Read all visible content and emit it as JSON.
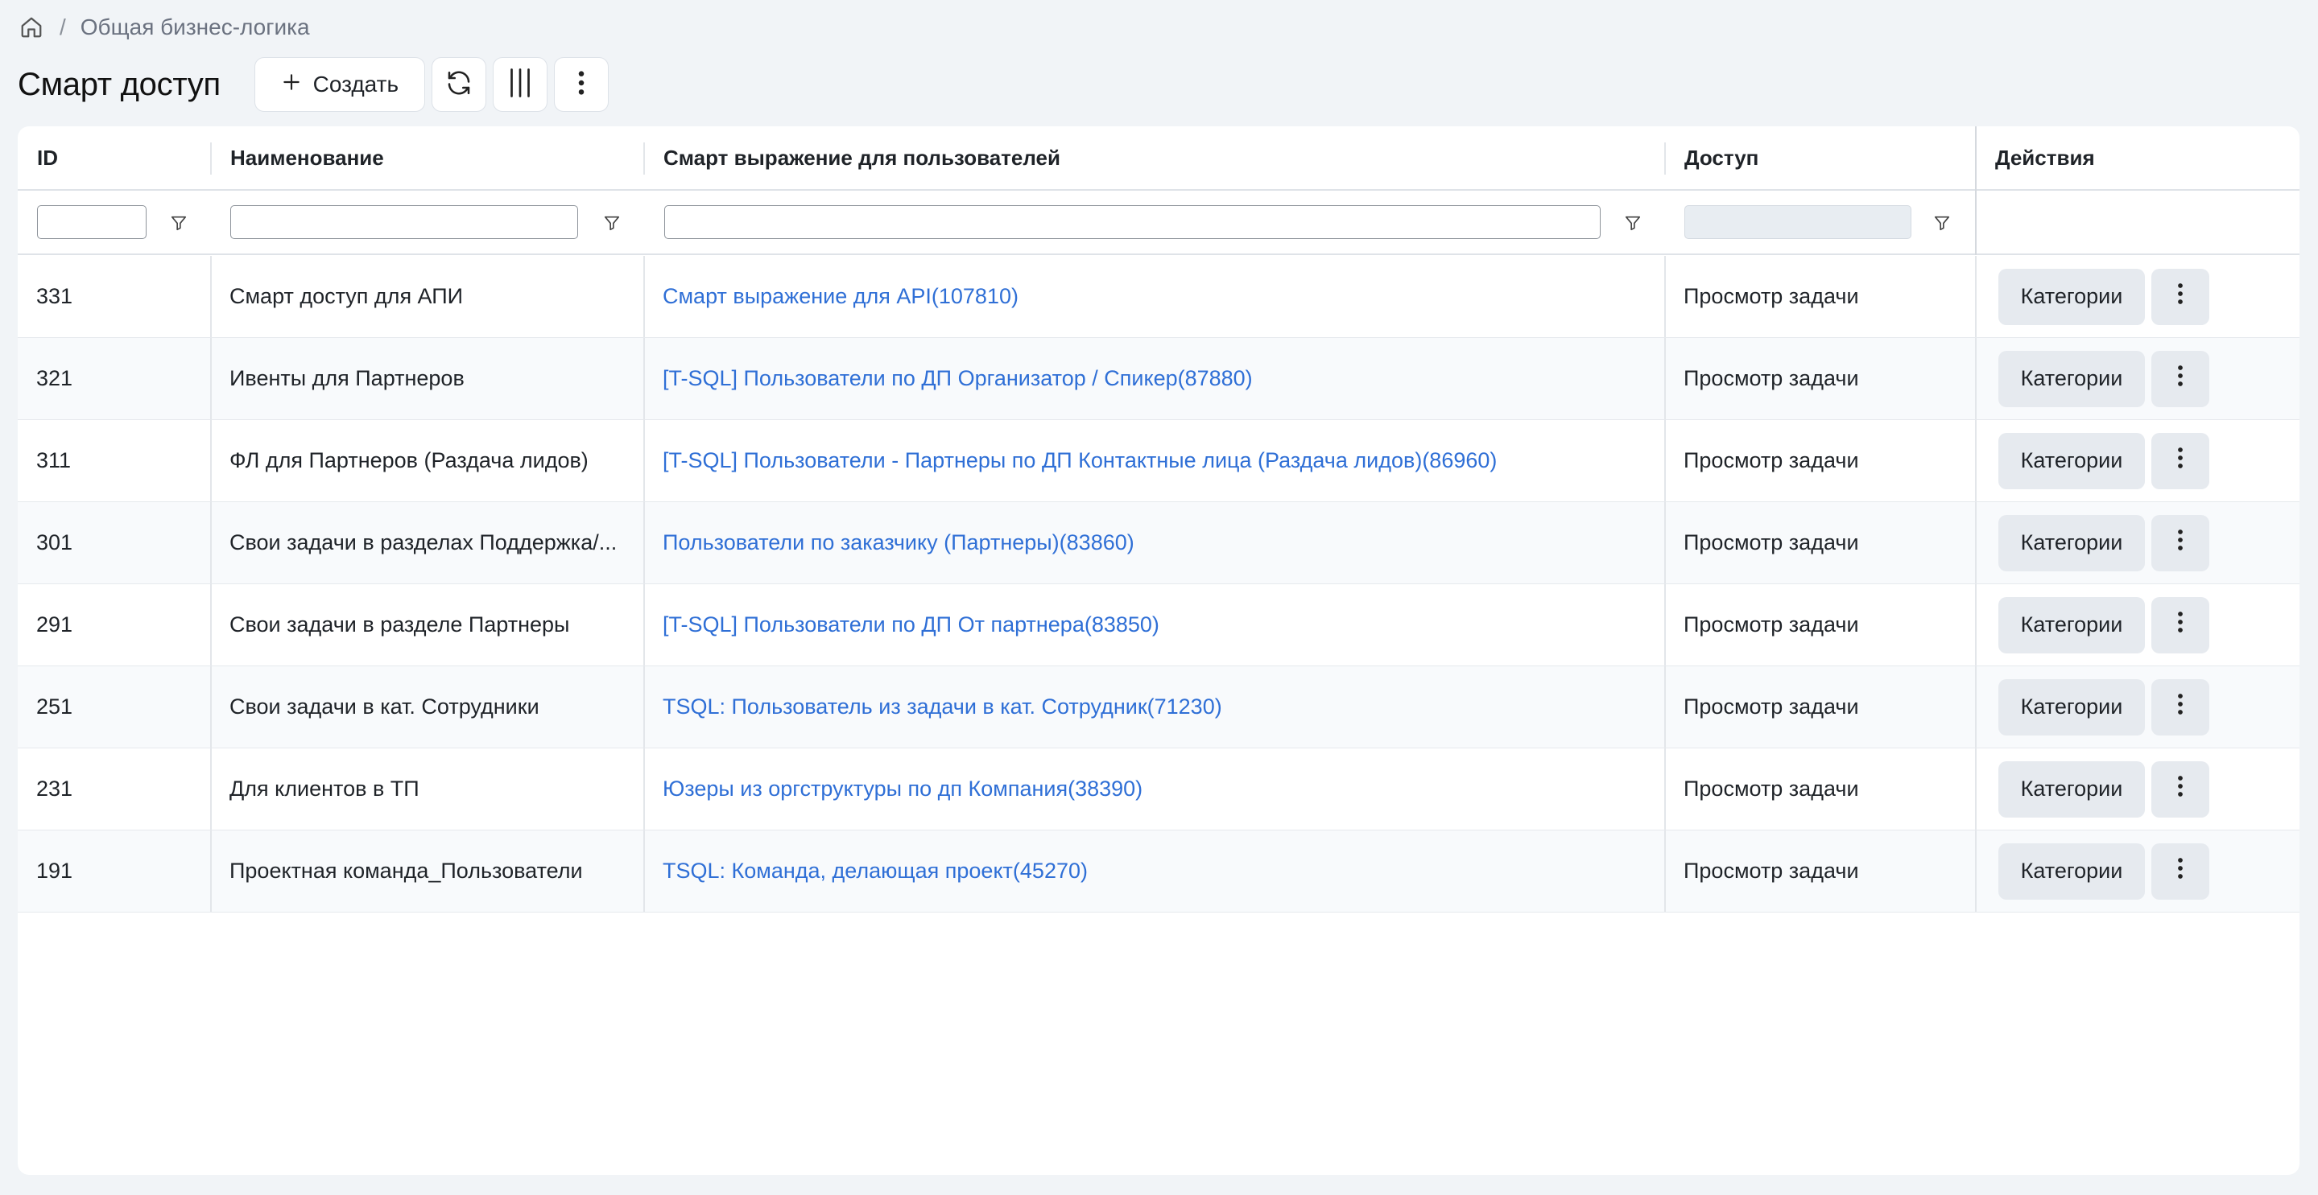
{
  "breadcrumb": {
    "home_icon": "home-icon",
    "separator": "/",
    "current": "Общая бизнес-логика"
  },
  "header": {
    "title": "Смарт доступ",
    "create_label": "Создать",
    "create_icon": "plus-icon",
    "refresh_icon": "refresh-icon",
    "columns_icon": "columns-icon",
    "more_icon": "more-vertical-icon"
  },
  "table": {
    "columns": [
      {
        "label": "ID"
      },
      {
        "label": "Наименование"
      },
      {
        "label": "Смарт выражение для пользователей"
      },
      {
        "label": "Доступ"
      },
      {
        "label": "Действия"
      }
    ],
    "filter_icon": "filter-icon",
    "rows": [
      {
        "id": "331",
        "name": "Смарт доступ для АПИ",
        "expression": "Смарт выражение для API(107810)",
        "access": "Просмотр задачи",
        "action": "Категории"
      },
      {
        "id": "321",
        "name": "Ивенты для Партнеров",
        "expression": "[T-SQL] Пользователи по ДП Организатор / Спикер(87880)",
        "access": "Просмотр задачи",
        "action": "Категории"
      },
      {
        "id": "311",
        "name": "ФЛ для Партнеров (Раздача лидов)",
        "expression": "[T-SQL] Пользователи - Партнеры по ДП Контактные лица (Раздача лидов)(86960)",
        "access": "Просмотр задачи",
        "action": "Категории"
      },
      {
        "id": "301",
        "name": "Свои задачи в разделах Поддержка/...",
        "expression": "Пользователи по заказчику (Партнеры)(83860)",
        "access": "Просмотр задачи",
        "action": "Категории"
      },
      {
        "id": "291",
        "name": "Свои задачи в разделе Партнеры",
        "expression": "[T-SQL] Пользователи по ДП От партнера(83850)",
        "access": "Просмотр задачи",
        "action": "Категории"
      },
      {
        "id": "251",
        "name": "Свои задачи в кат. Сотрудники",
        "expression": "TSQL: Пользователь из задачи в кат. Сотрудник(71230)",
        "access": "Просмотр задачи",
        "action": "Категории"
      },
      {
        "id": "231",
        "name": "Для клиентов в ТП",
        "expression": "Юзеры из оргструктуры по дп Компания(38390)",
        "access": "Просмотр задачи",
        "action": "Категории"
      },
      {
        "id": "191",
        "name": "Проектная команда_Пользователи",
        "expression": "TSQL: Команда, делающая проект(45270)",
        "access": "Просмотр задачи",
        "action": "Категории"
      }
    ]
  }
}
